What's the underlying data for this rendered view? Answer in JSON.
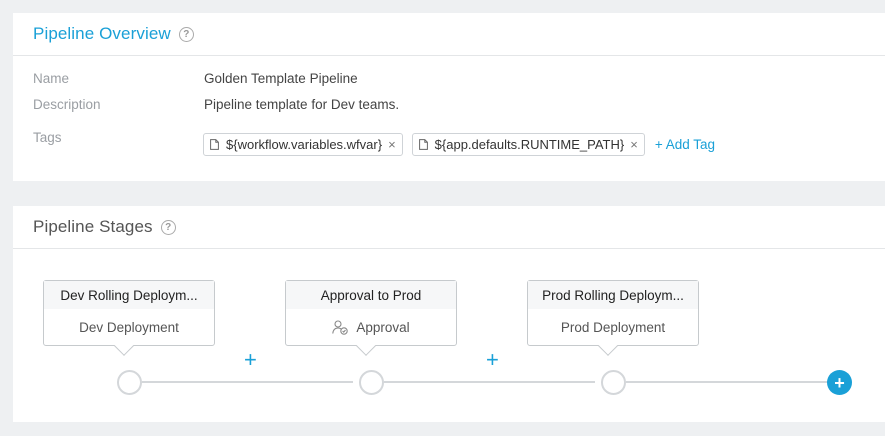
{
  "overview": {
    "title": "Pipeline Overview",
    "help": "?",
    "fields": {
      "name_label": "Name",
      "name_value": "Golden Template Pipeline",
      "description_label": "Description",
      "description_value": "Pipeline template for Dev teams.",
      "tags_label": "Tags"
    },
    "tags": [
      {
        "text": "${workflow.variables.wfvar}",
        "remove": "×"
      },
      {
        "text": "${app.defaults.RUNTIME_PATH}",
        "remove": "×"
      }
    ],
    "add_tag_label": "+ Add Tag"
  },
  "stages": {
    "title": "Pipeline Stages",
    "help": "?",
    "items": [
      {
        "header": "Dev Rolling Deploym...",
        "body": "Dev Deployment"
      },
      {
        "header": "Approval to Prod",
        "body": "Approval",
        "icon": "approval-user-icon"
      },
      {
        "header": "Prod Rolling Deploym...",
        "body": "Prod Deployment"
      }
    ],
    "insert_plus": "+",
    "add_stage": "+"
  },
  "colors": {
    "accent": "#1aa0d7",
    "background": "#eef0f2",
    "border": "#c6cacd"
  }
}
